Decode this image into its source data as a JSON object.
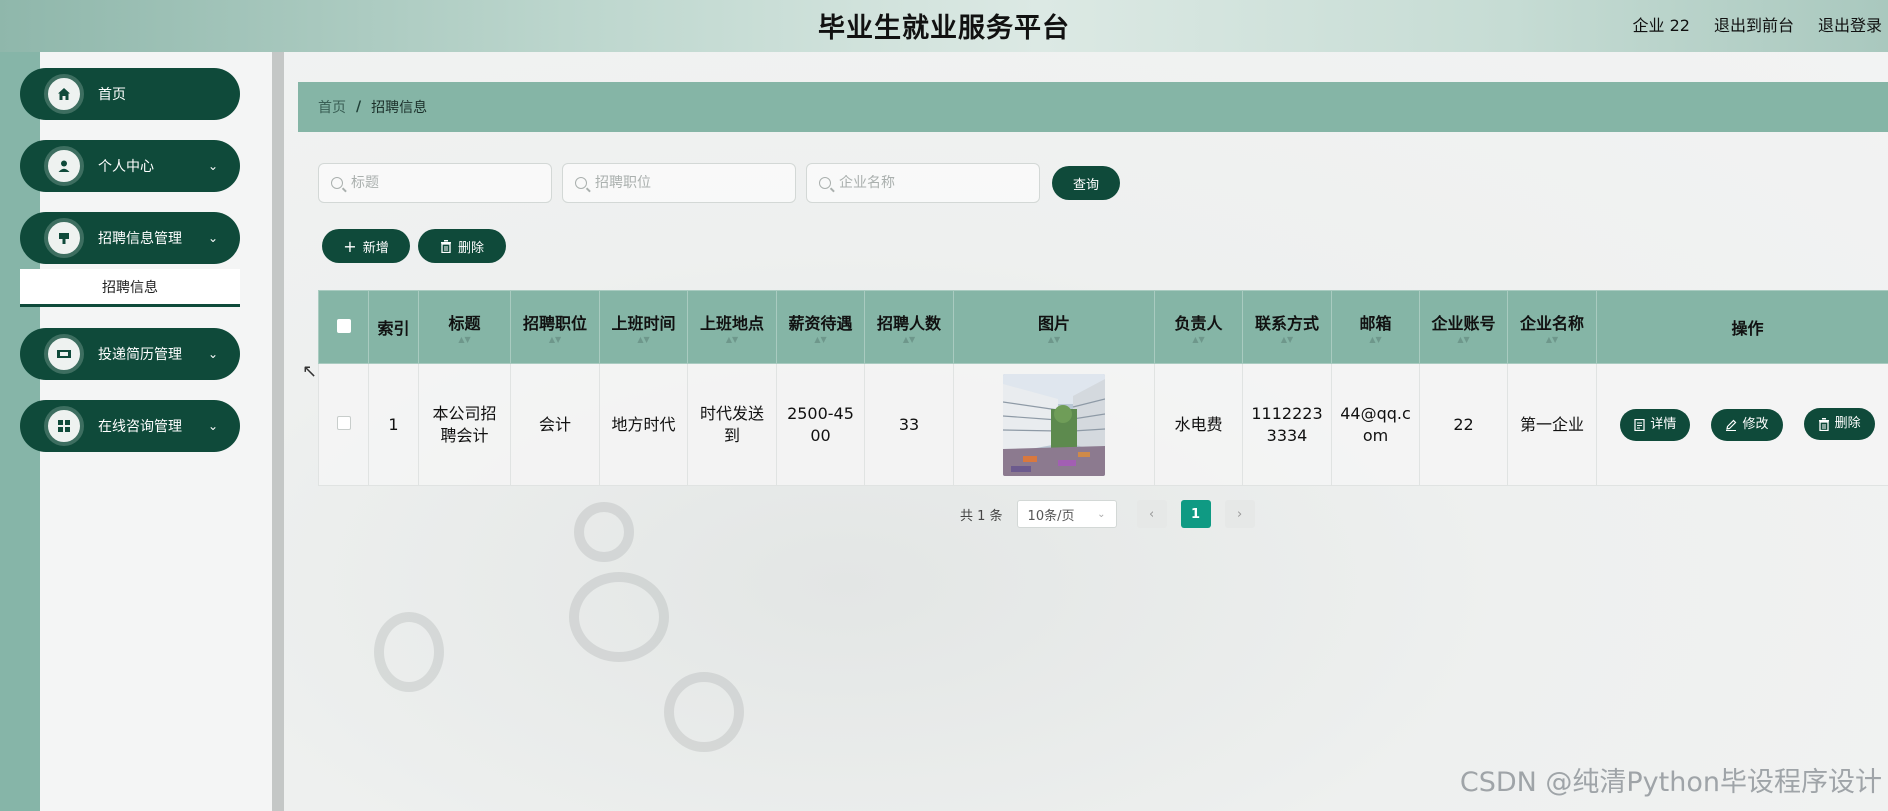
{
  "header": {
    "title": "毕业生就业服务平台",
    "user": "企业 22",
    "to_front": "退出到前台",
    "logout": "退出登录"
  },
  "sidebar": {
    "items": [
      {
        "label": "首页",
        "icon": "home-icon"
      },
      {
        "label": "个人中心",
        "icon": "user-icon"
      },
      {
        "label": "招聘信息管理",
        "icon": "briefcase-icon"
      },
      {
        "label": "投递简历管理",
        "icon": "resume-icon"
      },
      {
        "label": "在线咨询管理",
        "icon": "grid-icon"
      }
    ],
    "submenu": "招聘信息"
  },
  "breadcrumb": {
    "home": "首页",
    "separator": "/",
    "current": "招聘信息"
  },
  "search": {
    "title_placeholder": "标题",
    "position_placeholder": "招聘职位",
    "company_placeholder": "企业名称",
    "query_button": "查询"
  },
  "actions": {
    "add": "新增",
    "delete": "删除"
  },
  "table": {
    "headers": [
      "索引",
      "标题",
      "招聘职位",
      "上班时间",
      "上班地点",
      "薪资待遇",
      "招聘人数",
      "图片",
      "负责人",
      "联系方式",
      "邮箱",
      "企业账号",
      "企业名称",
      "操作"
    ],
    "rows": [
      {
        "index": "1",
        "title": "本公司招聘会计",
        "position": "会计",
        "work_time": "地方时代",
        "location": "时代发送到",
        "salary": "2500-4500",
        "headcount": "33",
        "contact_person": "水电费",
        "phone": "11122233334",
        "email": "44@qq.com",
        "account": "22",
        "company": "第一企业",
        "btn_detail": "详情",
        "btn_edit": "修改",
        "btn_delete": "删除"
      }
    ]
  },
  "pagination": {
    "total": "共 1 条",
    "page_size": "10条/页",
    "current_page": "1"
  },
  "watermark": "CSDN @纯清Python毕设程序设计",
  "colors": {
    "primary": "#0f4a3a",
    "header_teal": "#85b5a6",
    "active_page": "#0f9a83"
  }
}
